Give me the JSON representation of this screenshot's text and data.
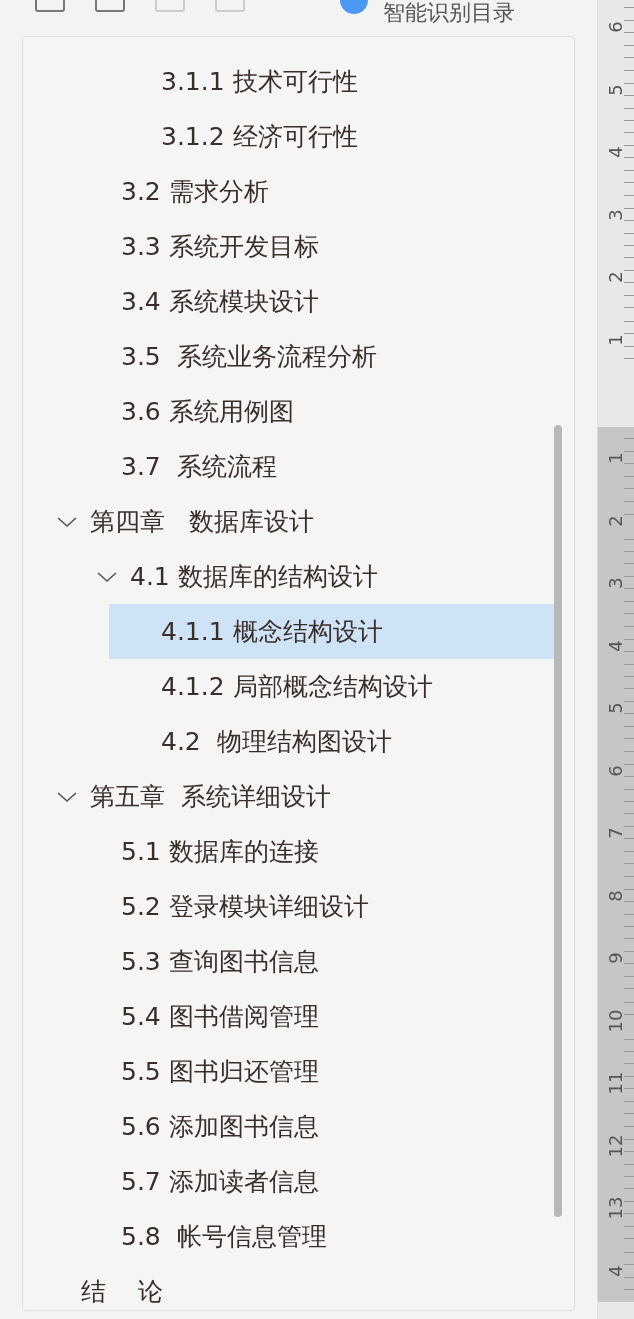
{
  "toolbar": {
    "toggle_on": true,
    "label": "智能识别目录"
  },
  "tree": {
    "scrolled_branch": [
      {
        "label": "3.1.1 技术可行性",
        "selected": false
      },
      {
        "label": "3.1.2 经济可行性",
        "selected": false
      }
    ],
    "scrolled_siblings": [
      {
        "label": "3.2 需求分析",
        "selected": false
      },
      {
        "label": "3.3 系统开发目标",
        "selected": false
      },
      {
        "label": "3.4 系统模块设计",
        "selected": false
      },
      {
        "label": "3.5  系统业务流程分析",
        "selected": false
      },
      {
        "label": "3.6 系统用例图",
        "selected": false
      },
      {
        "label": "3.7  系统流程",
        "selected": false
      }
    ],
    "items": [
      {
        "label": "第四章   数据库设计",
        "selected": false,
        "expanded": true,
        "children": [
          {
            "label": "4.1 数据库的结构设计",
            "selected": false,
            "expanded": true,
            "children": [
              {
                "label": "4.1.1 概念结构设计",
                "selected": true
              },
              {
                "label": "4.1.2 局部概念结构设计",
                "selected": false
              },
              {
                "label": "4.2  物理结构图设计",
                "selected": false
              }
            ]
          }
        ]
      },
      {
        "label": "第五章  系统详细设计",
        "selected": false,
        "expanded": true,
        "children": [
          {
            "label": "5.1 数据库的连接",
            "selected": false
          },
          {
            "label": "5.2 登录模块详细设计",
            "selected": false
          },
          {
            "label": "5.3 查询图书信息",
            "selected": false
          },
          {
            "label": "5.4 图书借阅管理",
            "selected": false
          },
          {
            "label": "5.5 图书归还管理",
            "selected": false
          },
          {
            "label": "5.6 添加图书信息",
            "selected": false
          },
          {
            "label": "5.7 添加读者信息",
            "selected": false
          },
          {
            "label": "5.8  帐号信息管理",
            "selected": false
          }
        ]
      },
      {
        "label": "结    论",
        "selected": false
      }
    ]
  },
  "ruler": {
    "upper_labels": [
      "6",
      "5",
      "4",
      "3",
      "2",
      "1"
    ],
    "lower_labels": [
      "1",
      "2",
      "3",
      "4",
      "5",
      "6",
      "7",
      "8",
      "9",
      "10",
      "11",
      "12",
      "13",
      "4"
    ]
  }
}
